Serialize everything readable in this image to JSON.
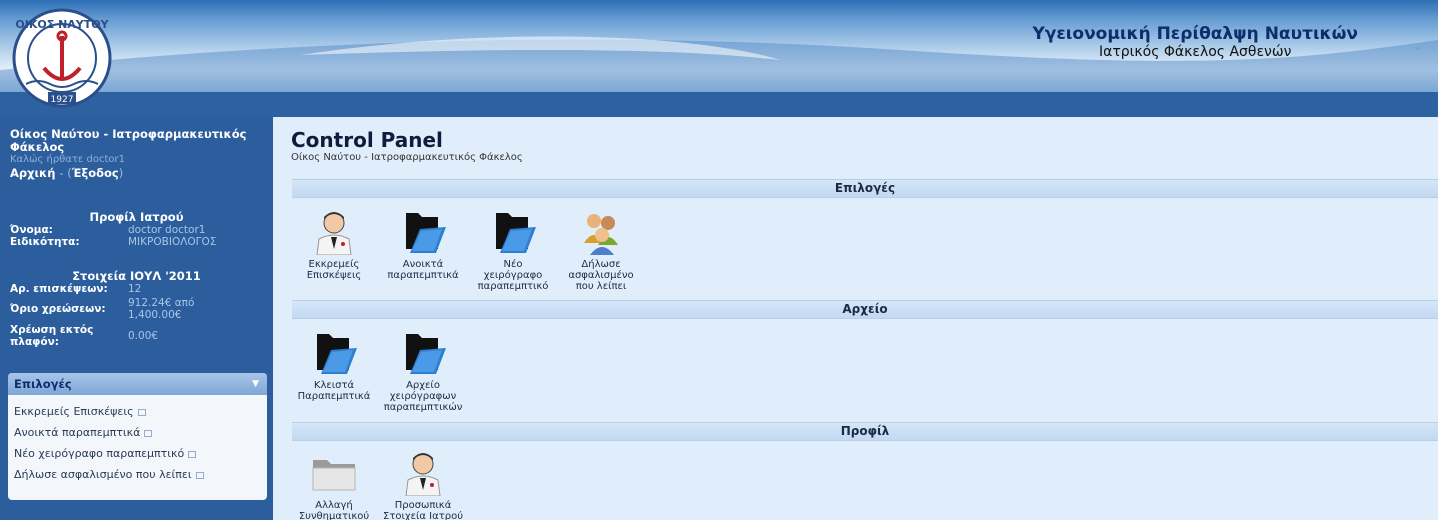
{
  "header": {
    "logo_text": "ΟΙΚΟΣ ΝΑΥΤΟΥ 1927",
    "title": "Υγειονομική Περίθαλψη Ναυτικών",
    "subtitle": "Ιατρικός Φάκελος Ασθενών"
  },
  "sidebar": {
    "site_name": "Οίκος Ναύτου - Ιατροφαρμακευτικός Φάκελος",
    "welcome": "Καλώς ήρθατε doctor1",
    "home_link": "Αρχική",
    "logout_link": "Έξοδος",
    "profile": {
      "title": "Προφίλ Ιατρού",
      "name_label": "Όνομα:",
      "name_value": "doctor doctor1",
      "specialty_label": "Ειδικότητα:",
      "specialty_value": "ΜΙΚΡΟΒΙΟΛΟΓΟΣ"
    },
    "stats": {
      "title": "Στοιχεία ΙΟΥΛ '2011",
      "visits_label": "Αρ. επισκέψεων:",
      "visits_value": "12",
      "limit_label": "Όριο χρεώσεων:",
      "limit_value_1": "912.24€ από",
      "limit_value_2": "1,400.00€",
      "extra_label_1": "Χρέωση εκτός",
      "extra_label_2": "πλαφόν:",
      "extra_value": "0.00€"
    },
    "options": {
      "title": "Επιλογές",
      "items": [
        "Εκκρεμείς Επισκέψεις",
        "Ανοικτά παραπεμπτικά",
        "Νέο χειρόγραφο παραπεμπτικό",
        "Δήλωσε ασφαλισμένο που λείπει"
      ]
    }
  },
  "main": {
    "title": "Control Panel",
    "subtitle": "Οίκος Ναύτου - Ιατροφαρμακευτικός Φάκελος",
    "sections": [
      {
        "title": "Επιλογές",
        "tiles": [
          {
            "icon": "doctor-icon",
            "line1": "Εκκρεμείς",
            "line2": "Επισκέψεις",
            "line3": ""
          },
          {
            "icon": "folder-icon",
            "line1": "Ανοικτά",
            "line2": "παραπεμπτικά",
            "line3": ""
          },
          {
            "icon": "folder-icon",
            "line1": "Νέο",
            "line2": "χειρόγραφο",
            "line3": "παραπεμπτικό"
          },
          {
            "icon": "users-icon",
            "line1": "Δήλωσε",
            "line2": "ασφαλισμένο",
            "line3": "που λείπει"
          }
        ]
      },
      {
        "title": "Αρχείο",
        "tiles": [
          {
            "icon": "folder-icon",
            "line1": "Κλειστά",
            "line2": "Παραπεμπτικά",
            "line3": ""
          },
          {
            "icon": "folder-icon",
            "line1": "Αρχείο",
            "line2": "χειρόγραφων",
            "line3": "παραπεμπτικών"
          }
        ]
      },
      {
        "title": "Προφίλ",
        "tiles": [
          {
            "icon": "gray-folder-icon",
            "line1": "Αλλαγή",
            "line2": "Συνθηματικού",
            "line3": ""
          },
          {
            "icon": "doctor-icon",
            "line1": "Προσωπικά",
            "line2": "Στοιχεία Ιατρού",
            "line3": ""
          }
        ]
      }
    ]
  },
  "colors": {
    "sidebar_bg": "#2c5e9e",
    "main_bg": "#e0eefb",
    "section_bar": "#c8dcf2",
    "title_navy": "#0e2d6e"
  }
}
